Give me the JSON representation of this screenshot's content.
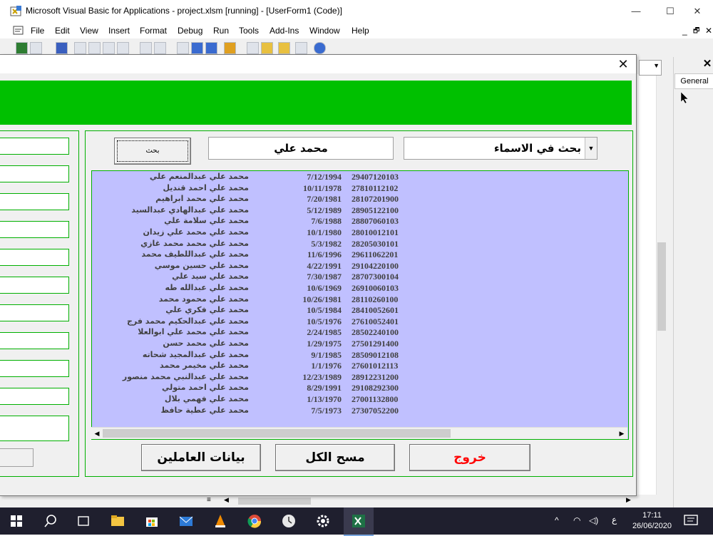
{
  "window": {
    "title": "Microsoft Visual Basic for Applications - project.xlsm [running] - [UserForm1 (Code)]",
    "controls": {
      "minimize": "—",
      "maximize": "☐",
      "close": "✕"
    }
  },
  "menubar": {
    "items": [
      "File",
      "Edit",
      "View",
      "Insert",
      "Format",
      "Debug",
      "Run",
      "Tools",
      "Add-Ins",
      "Window",
      "Help"
    ],
    "inner_controls": {
      "minimize": "_",
      "restore": "🗗",
      "close": "✕"
    }
  },
  "right_panel": {
    "tab_label": "General"
  },
  "userform": {
    "close_glyph": "✕",
    "search_button_label": "بحث",
    "name_input_value": "محمد علي",
    "search_combo_value": "بحث في الاسماء",
    "combo_arrow": "▼",
    "records": [
      {
        "name": "محمد علي عبدالمنعم علي",
        "date": "7/12/1994",
        "id": "29407120103"
      },
      {
        "name": "محمد علي احمد قنديل",
        "date": "10/11/1978",
        "id": "27810112102"
      },
      {
        "name": "محمد علي محمد ابراهيم",
        "date": "7/20/1981",
        "id": "28107201900"
      },
      {
        "name": "محمد علي عبدالهادي عبدالسيد",
        "date": "5/12/1989",
        "id": "28905122100"
      },
      {
        "name": "محمد علي سلامة علي",
        "date": "7/6/1988",
        "id": "28807060103"
      },
      {
        "name": "محمد علي محمد علي زيدان",
        "date": "10/1/1980",
        "id": "28010012101"
      },
      {
        "name": "محمد علي محمد محمد غازي",
        "date": "5/3/1982",
        "id": "28205030101"
      },
      {
        "name": "محمد علي عبداللطيف محمد",
        "date": "11/6/1996",
        "id": "29611062201"
      },
      {
        "name": "محمد علي حسين موسي",
        "date": "4/22/1991",
        "id": "29104220100"
      },
      {
        "name": "محمد علي سيد علي",
        "date": "7/30/1987",
        "id": "28707300104"
      },
      {
        "name": "محمد علي عبدالله طه",
        "date": "10/6/1969",
        "id": "26910060103"
      },
      {
        "name": "محمد علي محمود محمد",
        "date": "10/26/1981",
        "id": "28110260100"
      },
      {
        "name": "محمد علي فكري علي",
        "date": "10/5/1984",
        "id": "28410052601"
      },
      {
        "name": "محمد علي عبدالحكيم محمد فرج",
        "date": "10/5/1976",
        "id": "27610052401"
      },
      {
        "name": "محمد علي محمد علي ابوالعلا",
        "date": "2/24/1985",
        "id": "28502240100"
      },
      {
        "name": "محمد علي محمد حسن",
        "date": "1/29/1975",
        "id": "27501291400"
      },
      {
        "name": "محمد علي عبدالمجيد شحاته",
        "date": "9/1/1985",
        "id": "28509012108"
      },
      {
        "name": "محمد علي مخيمر محمد",
        "date": "1/1/1976",
        "id": "27601012113"
      },
      {
        "name": "محمد علي عبدالنبي محمد منصور",
        "date": "12/23/1989",
        "id": "28912231200"
      },
      {
        "name": "محمد علي احمد متولي",
        "date": "8/29/1991",
        "id": "29108292300"
      },
      {
        "name": "محمد علي فهمي بلال",
        "date": "1/13/1970",
        "id": "27001132800"
      },
      {
        "name": "محمد علي عطية حافظ",
        "date": "7/5/1973",
        "id": "27307052200"
      }
    ],
    "scroll_left": "◀",
    "scroll_right": "▶",
    "buttons": {
      "employees": "بيانات العاملين",
      "clear_all": "مسح الكل",
      "exit": "خروج"
    },
    "colors": {
      "header_green": "#00c000",
      "list_bg": "#c0c0ff",
      "exit_red": "#ff0000"
    }
  },
  "taskbar": {
    "time": "17:11",
    "date": "26/06/2020",
    "lang": "ع"
  }
}
